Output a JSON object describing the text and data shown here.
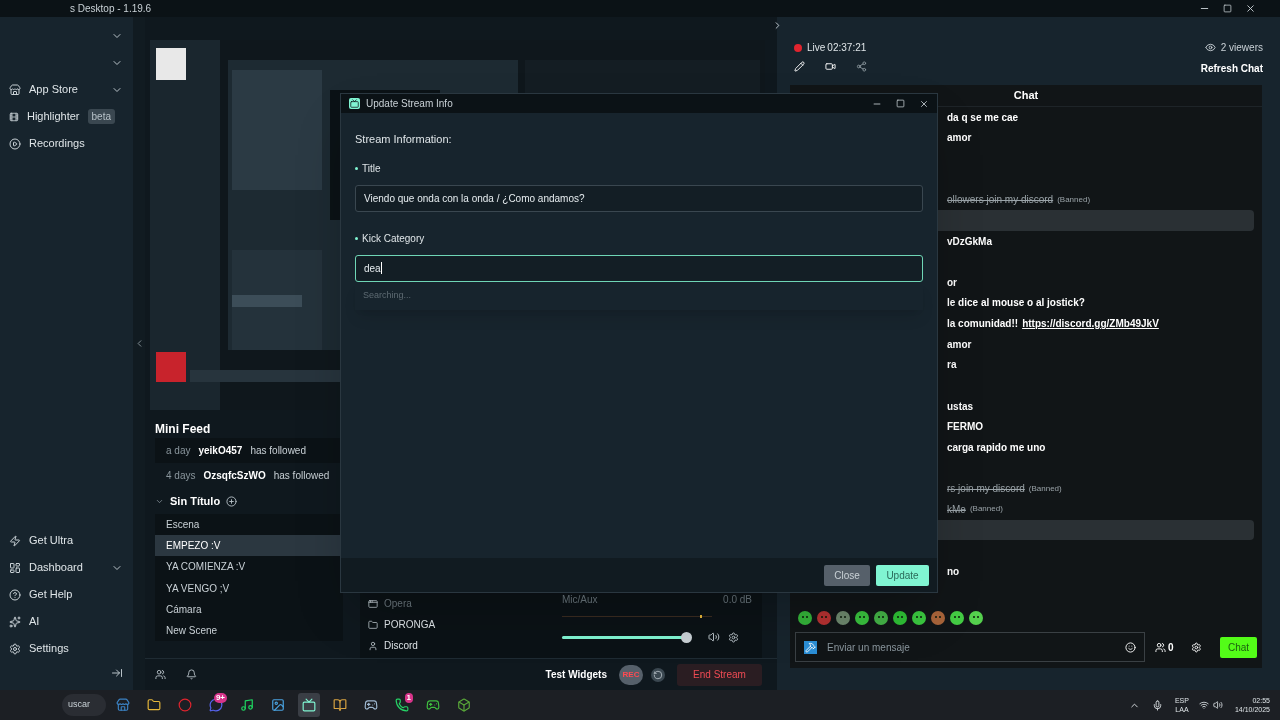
{
  "window": {
    "title": "s Desktop - 1.19.6"
  },
  "sidebar": {
    "items": [
      {
        "expandable": true
      },
      {
        "expandable": true
      },
      {
        "kind": "store",
        "label": "App Store",
        "expandable": true
      },
      {
        "kind": "highlighter",
        "label": "Highlighter",
        "badge": "beta",
        "expandable": false
      },
      {
        "kind": "recordings",
        "label": "Recordings",
        "expandable": false
      }
    ],
    "bottom_items": [
      {
        "kind": "ultra",
        "label": "Get Ultra",
        "expandable": false
      },
      {
        "kind": "dashboard",
        "label": "Dashboard",
        "expandable": true
      },
      {
        "kind": "help",
        "label": "Get Help",
        "expandable": false
      },
      {
        "kind": "ai",
        "label": "AI",
        "expandable": false
      },
      {
        "kind": "settings",
        "label": "Settings",
        "expandable": false
      }
    ]
  },
  "mini_feed": {
    "title": "Mini Feed",
    "rows": [
      {
        "time": "a day",
        "user": "yeikO457",
        "action": "has followed"
      },
      {
        "time": "4 days",
        "user": "OzsqfcSzWO",
        "action": "has followed"
      }
    ]
  },
  "scenes": {
    "title": "Sin Título",
    "items": [
      {
        "label": "Escena",
        "selected": false
      },
      {
        "label": "EMPEZO :V",
        "selected": true
      },
      {
        "label": "YA COMIENZA :V",
        "selected": false
      },
      {
        "label": "YA VENGO ;V",
        "selected": false
      },
      {
        "label": "Cámara",
        "selected": false
      },
      {
        "label": "New Scene",
        "selected": false
      }
    ]
  },
  "sources": [
    {
      "kind": "window",
      "label": "Opera"
    },
    {
      "kind": "folder",
      "label": "PORONGA"
    },
    {
      "kind": "user",
      "label": "Discord"
    }
  ],
  "mixer": {
    "label": "Mic/Aux",
    "reading": "0.0 dB",
    "level": 0.96
  },
  "bottom_bar": {
    "test_widgets": "Test Widgets",
    "rec": "REC",
    "end_stream": "End Stream"
  },
  "stream": {
    "live": "Live",
    "time": "02:37:21",
    "viewers": "2 viewers",
    "refresh": "Refresh Chat"
  },
  "chat": {
    "title": "Chat",
    "messages": [
      {
        "kind": "text",
        "text": "da q se me cae",
        "highlighted": false
      },
      {
        "kind": "text",
        "text": "amor",
        "highlighted": false
      },
      {
        "kind": "gap",
        "highlighted": false
      },
      {
        "kind": "gap",
        "highlighted": false
      },
      {
        "kind": "banned",
        "text": "ollowers join my discord",
        "tag": "(Banned)",
        "highlighted": false
      },
      {
        "kind": "gap",
        "highlighted": true
      },
      {
        "kind": "text",
        "text": "vDzGkMa",
        "highlighted": false
      },
      {
        "kind": "gap",
        "highlighted": false
      },
      {
        "kind": "text",
        "text": "or",
        "highlighted": false
      },
      {
        "kind": "text",
        "text": "le dice al mouse o al jostick?",
        "highlighted": false
      },
      {
        "kind": "link",
        "text": "la comunidad!!",
        "link": "https://discord.gg/ZMb49JkV",
        "highlighted": false
      },
      {
        "kind": "text",
        "text": "amor",
        "highlighted": false
      },
      {
        "kind": "text",
        "text": "ra",
        "highlighted": false
      },
      {
        "kind": "gap",
        "highlighted": false
      },
      {
        "kind": "text",
        "text": "ustas",
        "highlighted": false
      },
      {
        "kind": "text",
        "text": "FERMO",
        "highlighted": false
      },
      {
        "kind": "text",
        "text": "carga rapido me uno",
        "highlighted": false
      },
      {
        "kind": "gap",
        "highlighted": false
      },
      {
        "kind": "banned",
        "text": "rs join my discord",
        "tag": "(Banned)",
        "highlighted": false
      },
      {
        "kind": "banned",
        "text": "kMe",
        "tag": "(Banned)",
        "highlighted": false
      },
      {
        "kind": "gap",
        "highlighted": true
      },
      {
        "kind": "gap",
        "highlighted": false
      },
      {
        "kind": "text",
        "text": "no",
        "highlighted": false
      }
    ],
    "placeholder": "Enviar un mensaje",
    "points": "0",
    "send": "Chat"
  },
  "dialog": {
    "title": "Update Stream Info",
    "heading": "Stream Information:",
    "fields": [
      {
        "label": "Title",
        "required": true,
        "value": "Viendo que onda con la onda / ¿Como andamos?",
        "focused": false
      },
      {
        "label": "Kick Category",
        "required": true,
        "value": "dea",
        "focused": true
      }
    ],
    "status": "Searching...",
    "buttons": [
      {
        "kind": "secondary",
        "label": "Close"
      },
      {
        "kind": "primary",
        "label": "Update"
      }
    ]
  },
  "taskbar": {
    "search": "uscar",
    "apps": [
      {
        "kind": "store",
        "selected": false
      },
      {
        "kind": "folder",
        "selected": false
      },
      {
        "kind": "opera",
        "selected": false
      },
      {
        "kind": "discord",
        "badge": "9+",
        "selected": false
      },
      {
        "kind": "spotify",
        "selected": false
      },
      {
        "kind": "photos",
        "selected": false
      },
      {
        "kind": "streamlabs",
        "selected": true
      },
      {
        "kind": "book",
        "selected": false
      },
      {
        "kind": "steam",
        "selected": false
      },
      {
        "kind": "whatsapp",
        "badge": "1",
        "selected": false
      },
      {
        "kind": "xbox",
        "selected": false
      },
      {
        "kind": "minecraft",
        "selected": false
      }
    ],
    "language": "ESP",
    "layout": "LAA",
    "time": "02:55",
    "date": "14/10/2025"
  }
}
